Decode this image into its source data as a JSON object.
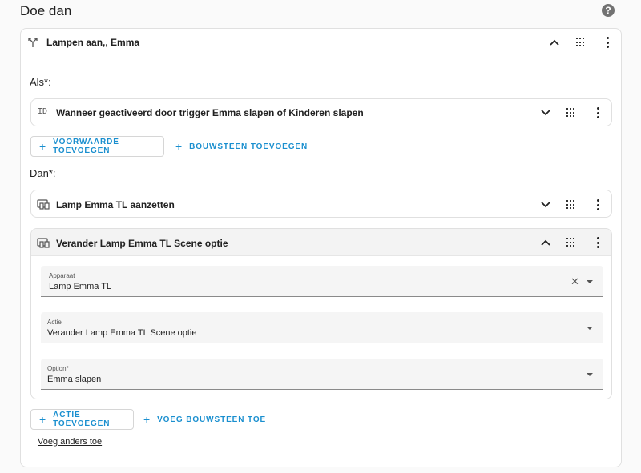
{
  "page": {
    "title": "Doe dan",
    "help_icon": "?"
  },
  "block": {
    "title": "Lampen aan,, Emma",
    "icon": "branch-icon"
  },
  "als": {
    "label": "Als*:",
    "condition_id_icon": "ID",
    "condition_title": "Wanneer geactiveerd door trigger Emma slapen of Kinderen slapen",
    "add_condition_label": "VOORWAARDE TOEVOEGEN",
    "add_building_block_label": "BOUWSTEEN TOEVOEGEN"
  },
  "dan": {
    "label": "Dan*:",
    "action1_title": "Lamp Emma TL aanzetten",
    "action2_title": "Verander Lamp Emma TL Scene optie",
    "fields": [
      {
        "label": "Apparaat",
        "value": "Lamp Emma TL"
      },
      {
        "label": "Actie",
        "value": "Verander Lamp Emma TL Scene optie"
      },
      {
        "label": "Option*",
        "value": "Emma slapen"
      }
    ],
    "add_action_label": "ACTIE TOEVOEGEN",
    "add_building_block_label": "VOEG BOUWSTEEN TOE"
  },
  "else_link": "Voeg anders toe",
  "colors": {
    "accent": "#1a8fcf",
    "card_border": "#e0e0e0",
    "field_bg": "#f5f5f5"
  }
}
